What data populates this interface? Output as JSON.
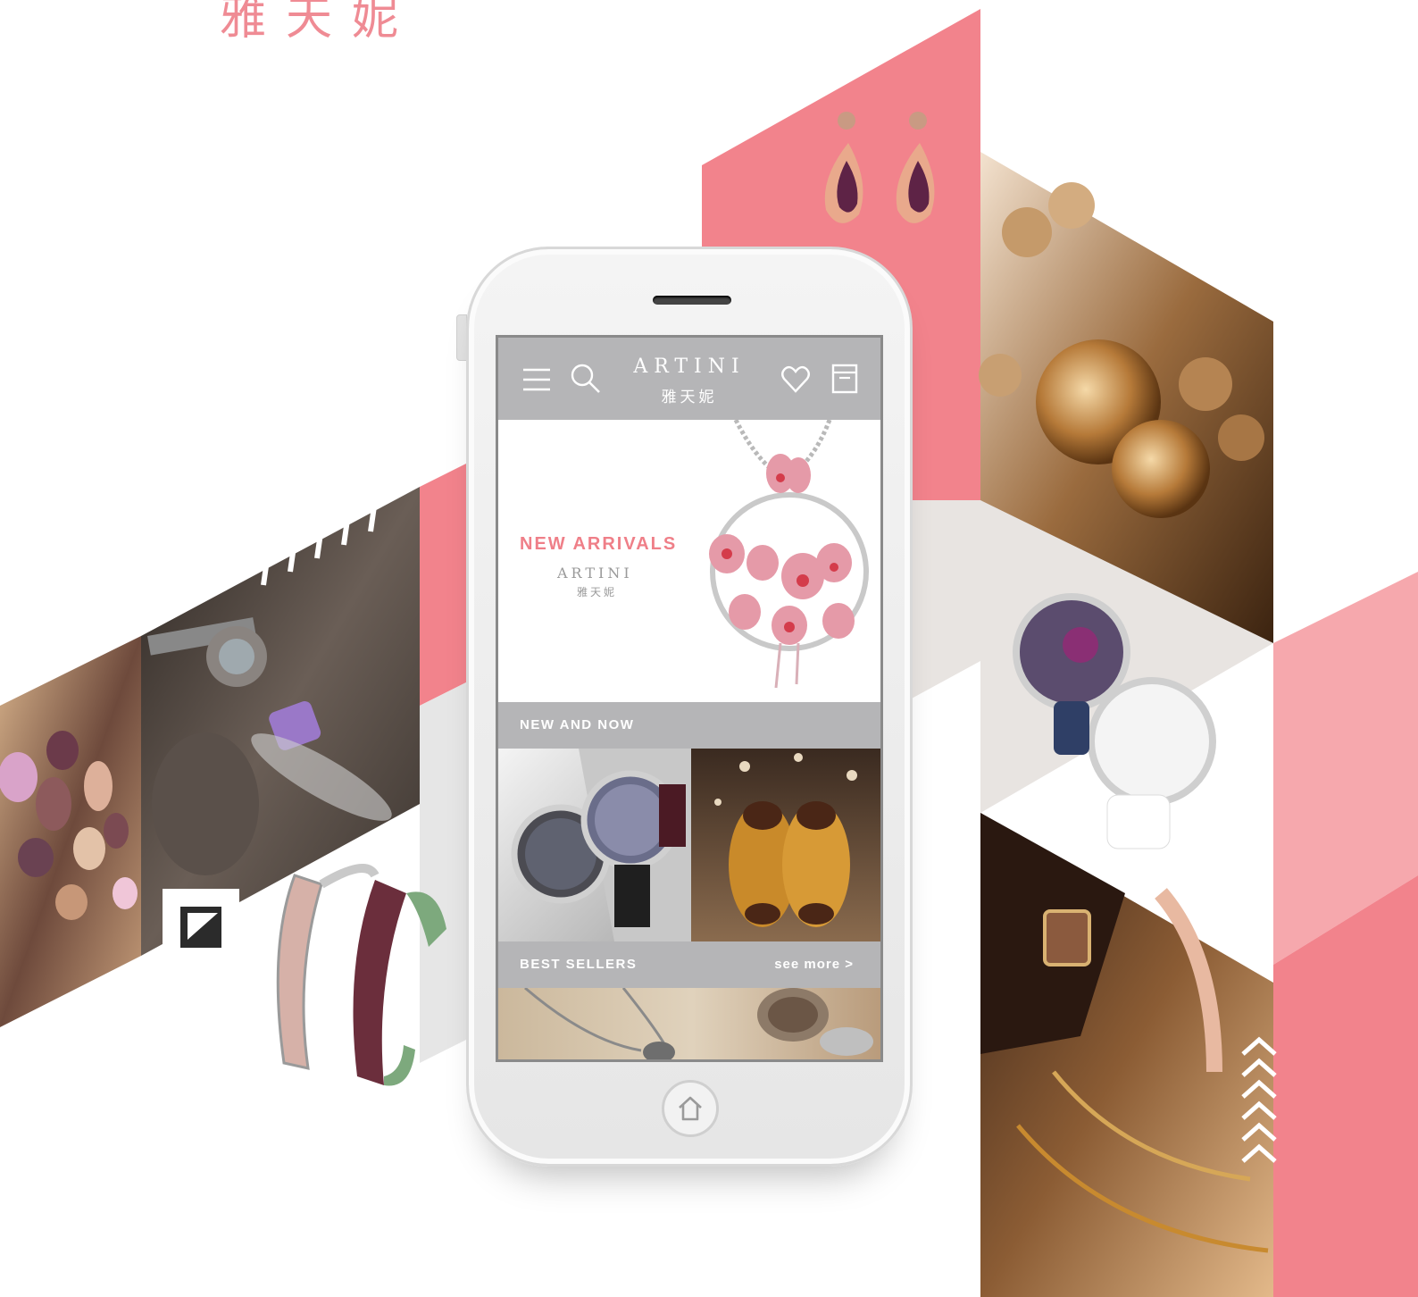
{
  "page": {
    "top_chinese": "雅天妮",
    "accent_color": "#f2838c",
    "light_pink": "#f6a8ad",
    "light_gray": "#e8e4e1"
  },
  "app": {
    "brand_en": "ARTINI",
    "brand_cn": "雅天妮",
    "header_icons": [
      "menu-icon",
      "search-icon",
      "heart-icon",
      "cart-icon"
    ],
    "hero": {
      "title": "NEW ARRIVALS",
      "brand_en": "ARTINI",
      "brand_cn": "雅天妮"
    },
    "sections": {
      "new_and_now": "NEW AND NOW",
      "best_sellers": "BEST SELLERS",
      "see_more": "see more >"
    }
  }
}
